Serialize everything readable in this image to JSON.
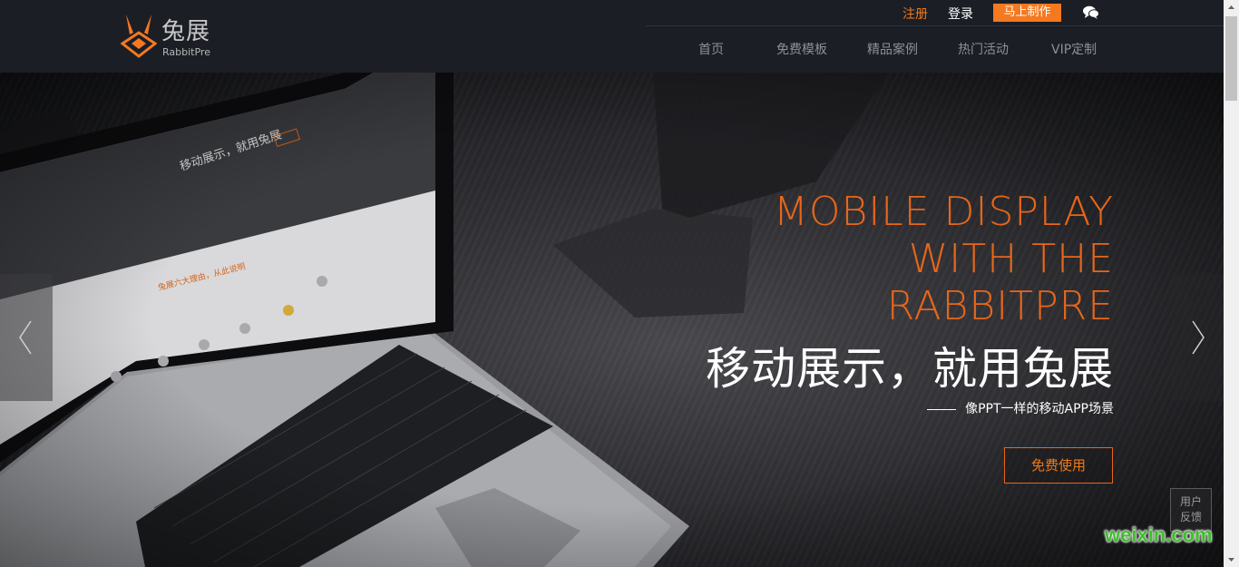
{
  "header": {
    "logo_cn": "兔展",
    "logo_en": "RabbitPre",
    "register_label": "注册",
    "login_label": "登录",
    "make_now_label": "马上制作",
    "chat_icon": "chat-bubbles-icon",
    "nav": [
      {
        "label": "首页"
      },
      {
        "label": "免费模板"
      },
      {
        "label": "精品案例"
      },
      {
        "label": "热门活动"
      },
      {
        "label": "VIP定制"
      }
    ]
  },
  "hero": {
    "headline_en": "MOBILE DISPLAY\nWITH THE\nRABBITPRE",
    "headline_cn": "移动展示，就用兔展",
    "subtitle": "像PPT一样的移动APP场景",
    "cta_label": "免费使用",
    "prev_icon": "chevron-left-icon",
    "next_icon": "chevron-right-icon",
    "screen_text_1": "移动展示，就用兔展",
    "screen_text_2": "兔展六大理由，从此说明",
    "feedback_label": "用户\n反馈"
  },
  "watermark": "weixin.com",
  "colors": {
    "accent": "#f47920",
    "header_bg": "#1c1e26",
    "headline_orange": "#e8661a"
  }
}
